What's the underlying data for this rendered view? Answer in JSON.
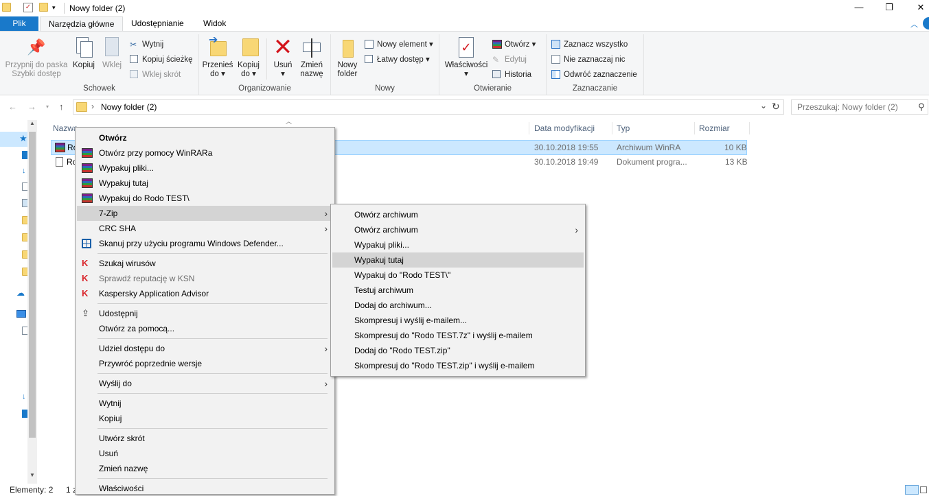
{
  "window": {
    "title": "Nowy folder (2)",
    "controls": {
      "minimize": "—",
      "maximize": "❐",
      "close": "✕"
    }
  },
  "ribbon_tabs": [
    "Plik",
    "Narzędzia główne",
    "Udostępnianie",
    "Widok"
  ],
  "ribbon": {
    "schowek": {
      "label": "Schowek",
      "pin_line1": "Przypnij do paska",
      "pin_line2": "Szybki dostęp",
      "copy": "Kopiuj",
      "paste": "Wklej",
      "cut": "Wytnij",
      "copy_path": "Kopiuj ścieżkę",
      "paste_shortcut": "Wklej skrót"
    },
    "organizowanie": {
      "label": "Organizowanie",
      "move_line1": "Przenieś",
      "move_line2": "do ▾",
      "copyto_line1": "Kopiuj",
      "copyto_line2": "do ▾",
      "delete_line1": "Usuń",
      "delete_line2": "▾",
      "rename_line1": "Zmień",
      "rename_line2": "nazwę"
    },
    "nowy": {
      "label": "Nowy",
      "newfolder_line1": "Nowy",
      "newfolder_line2": "folder",
      "new_item": "Nowy element ▾",
      "easy_access": "Łatwy dostęp ▾"
    },
    "otwieranie": {
      "label": "Otwieranie",
      "props_line1": "Właściwości",
      "props_line2": "▾",
      "open": "Otwórz ▾",
      "edit": "Edytuj",
      "history": "Historia"
    },
    "zaznaczanie": {
      "label": "Zaznaczanie",
      "select_all": "Zaznacz wszystko",
      "select_none": "Nie zaznaczaj nic",
      "invert": "Odwróć zaznaczenie"
    }
  },
  "address": {
    "path": "Nowy folder (2)",
    "search_placeholder": "Przeszukaj: Nowy folder (2)"
  },
  "columns": {
    "name": "Nazwa",
    "date": "Data modyfikacji",
    "type": "Typ",
    "size": "Rozmiar"
  },
  "files": [
    {
      "name": "Ro",
      "date": "30.10.2018 19:55",
      "type": "Archiwum WinRA",
      "size": "10 KB"
    },
    {
      "name": "Ro",
      "date": "30.10.2018 19:49",
      "type": "Dokument progra...",
      "size": "13 KB"
    }
  ],
  "status": {
    "items": "Elementy: 2",
    "selected": "1 z"
  },
  "context_menu": {
    "open": "Otwórz",
    "open_winrar": "Otwórz przy pomocy WinRARa",
    "extract_files": "Wypakuj pliki...",
    "extract_here": "Wypakuj tutaj",
    "extract_to": "Wypakuj do Rodo TEST\\",
    "sevenzip": "7-Zip",
    "crc": "CRC SHA",
    "defender": "Skanuj przy użyciu programu Windows Defender...",
    "scan_virus": "Szukaj wirusów",
    "ksn": "Sprawdź reputację w KSN",
    "kaspersky_advisor": "Kaspersky Application Advisor",
    "share": "Udostępnij",
    "open_with": "Otwórz za pomocą...",
    "give_access": "Udziel dostępu do",
    "restore": "Przywróć poprzednie wersje",
    "send_to": "Wyślij do",
    "cut": "Wytnij",
    "copy": "Kopiuj",
    "create_shortcut": "Utwórz skrót",
    "delete": "Usuń",
    "rename": "Zmień nazwę",
    "properties": "Właściwości"
  },
  "submenu_7zip": [
    "Otwórz archiwum",
    "Otwórz archiwum",
    "Wypakuj pliki...",
    "Wypakuj tutaj",
    "Wypakuj do \"Rodo TEST\\\"",
    "Testuj archiwum",
    "Dodaj do archiwum...",
    "Skompresuj i wyślij e-mailem...",
    "Skompresuj do \"Rodo TEST.7z\" i wyślij e-mailem",
    "Dodaj do \"Rodo TEST.zip\"",
    "Skompresuj do \"Rodo TEST.zip\" i wyślij e-mailem"
  ],
  "colors": {
    "accent": "#1979ca",
    "selection": "#cce8ff",
    "menu_bg": "#f2f2f2",
    "menu_highlight": "#d4d4d4"
  }
}
